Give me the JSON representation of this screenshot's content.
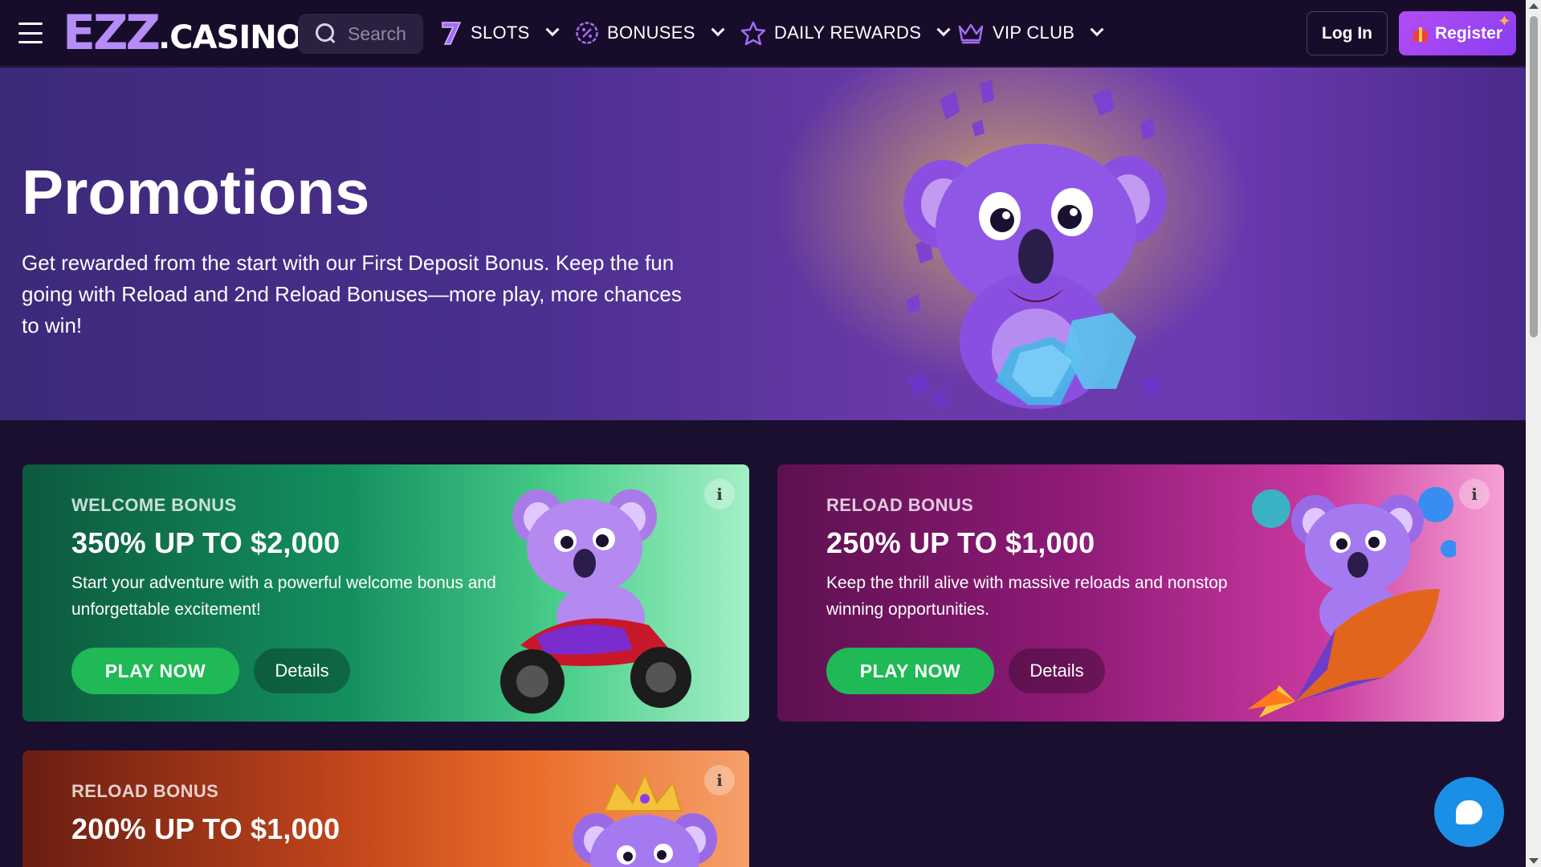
{
  "header": {
    "logo_main": "EZZ",
    "logo_suffix": ".CASINO",
    "search_placeholder": "Search",
    "nav": [
      {
        "label": "SLOTS",
        "icon": "seven-icon"
      },
      {
        "label": "BONUSES",
        "icon": "percent-badge-icon"
      },
      {
        "label": "DAILY REWARDS",
        "icon": "star-icon"
      },
      {
        "label": "VIP CLUB",
        "icon": "crown-icon"
      }
    ],
    "login_label": "Log In",
    "register_label": "Register"
  },
  "hero": {
    "title": "Promotions",
    "text": "Get rewarded from the start with our First Deposit Bonus. Keep the fun going with Reload and 2nd Reload Bonuses—more play, more chances to win!"
  },
  "promos": [
    {
      "kicker": "WELCOME BONUS",
      "headline": "350% UP TO $2,000",
      "description": "Start your adventure with a powerful welcome bonus and unforgettable excitement!",
      "play_label": "PLAY NOW",
      "details_label": "Details"
    },
    {
      "kicker": "RELOAD BONUS",
      "headline": "250% UP TO $1,000",
      "description": "Keep the thrill alive with massive reloads and nonstop winning opportunities.",
      "play_label": "PLAY NOW",
      "details_label": "Details"
    },
    {
      "kicker": "RELOAD BONUS",
      "headline": "200% UP TO $1,000"
    }
  ],
  "info_glyph": "i",
  "colors": {
    "accent_purple": "#b68cf7",
    "play_green": "#1fb956",
    "register_purple": "#a645f3",
    "chat_blue": "#1b8fe6"
  }
}
